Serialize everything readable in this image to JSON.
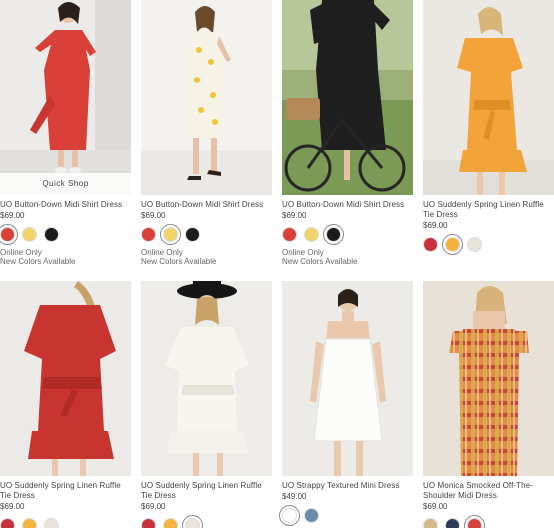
{
  "products": [
    {
      "name": "UO Button-Down Midi Shirt Dress",
      "price": "$69.00",
      "quick_shop": "Quick Shop",
      "swatches": [
        {
          "color": "#d9403a",
          "selected": true
        },
        {
          "color": "#f1d36b",
          "selected": false
        },
        {
          "color": "#1c1c1c",
          "selected": false
        }
      ],
      "notes": [
        "Online Only",
        "New Colors Available"
      ],
      "image": "model-red-button-down-dress",
      "bg": "#e9e6e2"
    },
    {
      "name": "UO Button-Down Midi Shirt Dress",
      "price": "$69.00",
      "swatches": [
        {
          "color": "#d9403a",
          "selected": false
        },
        {
          "color": "#f1d36b",
          "selected": true
        },
        {
          "color": "#1c1c1c",
          "selected": false
        }
      ],
      "notes": [
        "Online Only",
        "New Colors Available"
      ],
      "image": "model-yellow-floral-dress",
      "bg": "#f3f2ef"
    },
    {
      "name": "UO Button-Down Midi Shirt Dress",
      "price": "$69.00",
      "swatches": [
        {
          "color": "#d9403a",
          "selected": false
        },
        {
          "color": "#f1d36b",
          "selected": false
        },
        {
          "color": "#1c1c1c",
          "selected": true
        }
      ],
      "notes": [
        "Online Only",
        "New Colors Available"
      ],
      "image": "model-black-dress-bicycle",
      "bg": "#8aa06a"
    },
    {
      "name": "UO Suddenly Spring Linen Ruffle Tie Dress",
      "price": "$69.00",
      "swatches": [
        {
          "color": "#c9323a",
          "selected": false
        },
        {
          "color": "#f4b33c",
          "selected": true
        },
        {
          "color": "#e8e4dc",
          "selected": false
        }
      ],
      "notes": [],
      "image": "model-orange-ruffle-dress",
      "bg": "#ebe8e4"
    },
    {
      "name": "UO Suddenly Spring Linen Ruffle Tie Dress",
      "price": "$69.00",
      "swatches": [
        {
          "color": "#c9323a",
          "selected": false
        },
        {
          "color": "#f4b33c",
          "selected": false
        },
        {
          "color": "#e8e4dc",
          "selected": false
        }
      ],
      "notes": [],
      "image": "model-red-ruffle-dress",
      "bg": "#eceae6"
    },
    {
      "name": "UO Suddenly Spring Linen Ruffle Tie Dress",
      "price": "$69.00",
      "swatches": [
        {
          "color": "#c9323a",
          "selected": false
        },
        {
          "color": "#f4b33c",
          "selected": false
        },
        {
          "color": "#e8e4dc",
          "selected": true
        }
      ],
      "notes": [],
      "image": "model-white-dress-hat",
      "bg": "#eeece8"
    },
    {
      "name": "UO Strappy Textured Mini Dress",
      "price": "$49.00",
      "swatches": [
        {
          "color": "#ffffff",
          "selected": true
        },
        {
          "color": "#6a8aab",
          "selected": false
        }
      ],
      "notes": [],
      "image": "model-white-mini-dress",
      "bg": "#ecebe8"
    },
    {
      "name": "UO Monica Smocked Off-The-Shoulder Midi Dress",
      "price": "$69.00",
      "swatches": [
        {
          "color": "#d6b98a",
          "selected": false
        },
        {
          "color": "#2f3b5a",
          "selected": false
        },
        {
          "color": "#d9403a",
          "selected": true
        }
      ],
      "notes": [],
      "image": "model-plaid-off-shoulder-dress",
      "bg": "#e7e1d8"
    }
  ]
}
